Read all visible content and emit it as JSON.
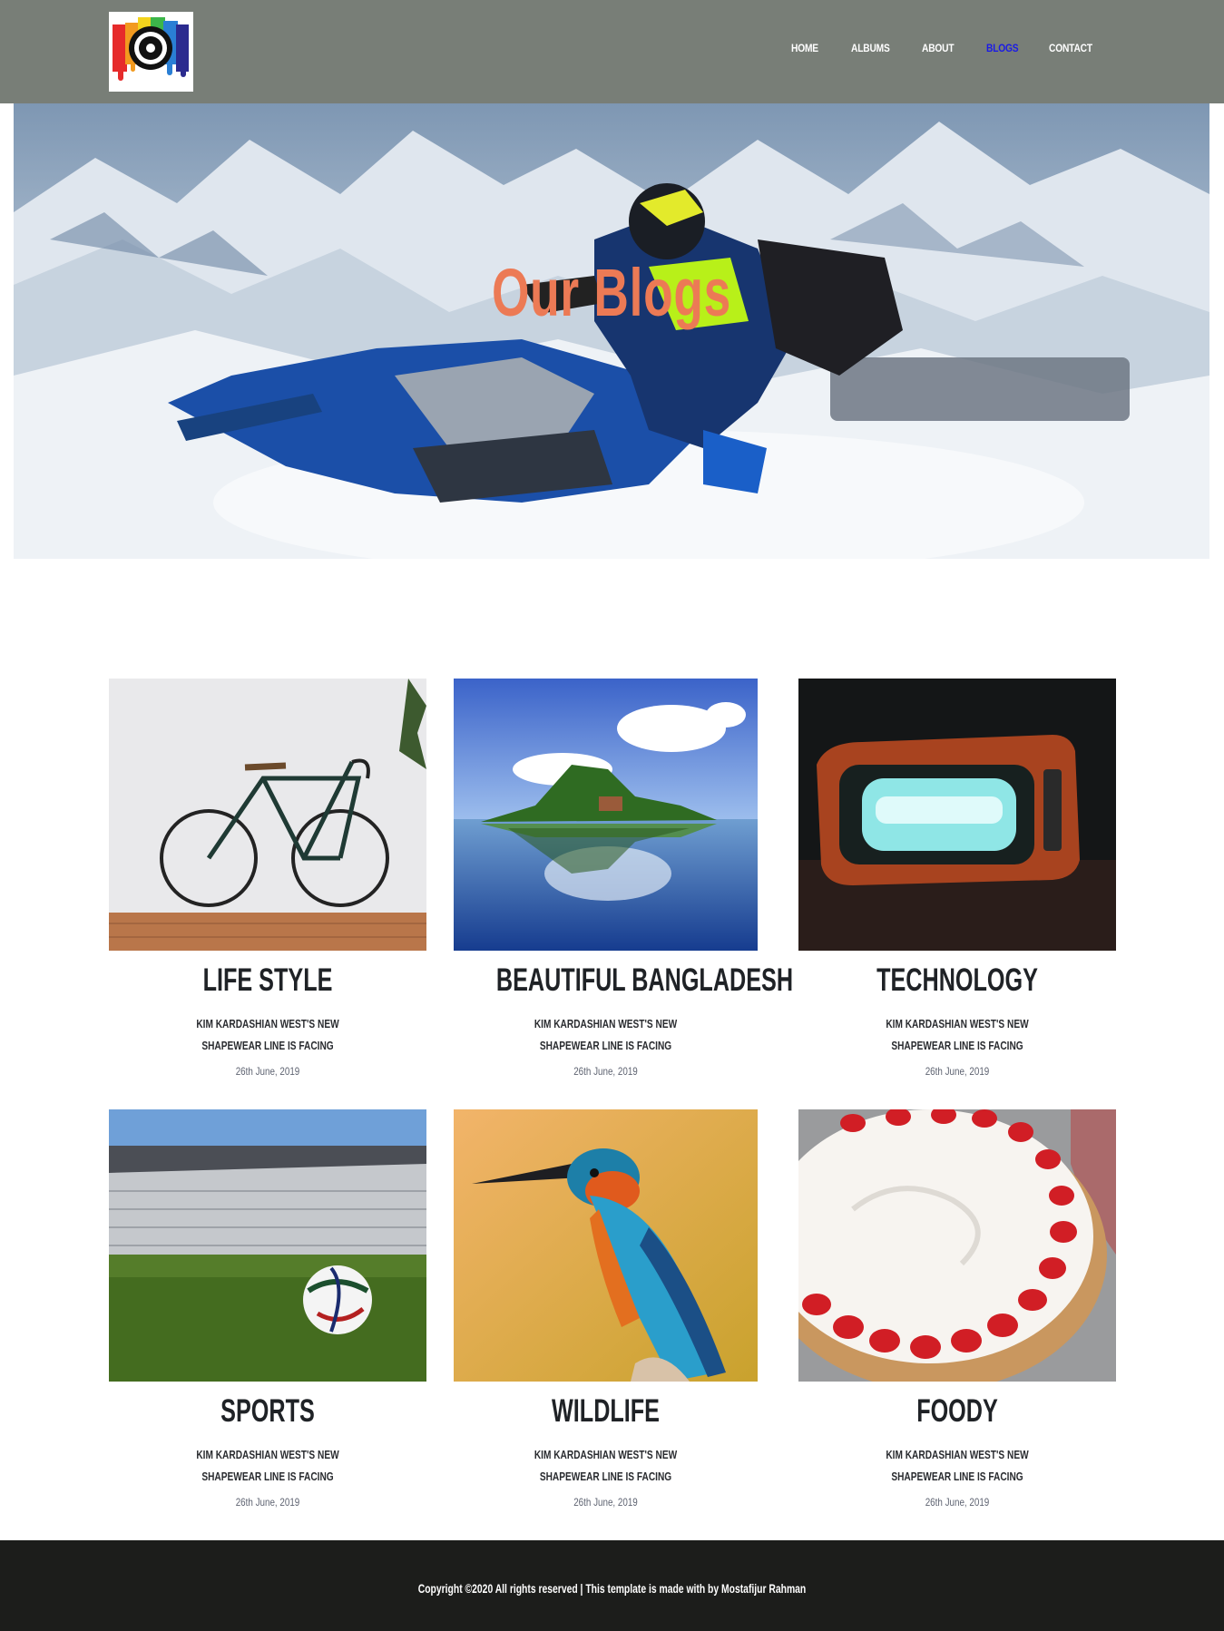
{
  "header": {
    "logo_icon": "camera-logo-icon",
    "nav": [
      {
        "label": "HOME"
      },
      {
        "label": "ALBUMS"
      },
      {
        "label": "ABOUT"
      },
      {
        "label": "BLOGS",
        "active": true
      },
      {
        "label": "CONTACT"
      }
    ],
    "colors": {
      "background": "#787e77",
      "nav_text": "#ffffff",
      "nav_active": "#1a1ae6"
    }
  },
  "hero": {
    "title": "Our Blogs",
    "title_color": "#ec7a55"
  },
  "blogs": [
    {
      "title": "LIFE STYLE",
      "excerpt_line1": "KIM KARDASHIAN WEST'S NEW",
      "excerpt_line2": "SHAPEWEAR LINE IS FACING",
      "date": "26th June, 2019",
      "image": "bicycle-photo"
    },
    {
      "title": "BEAUTIFUL BANGLADESH",
      "excerpt_line1": "KIM KARDASHIAN WEST'S NEW",
      "excerpt_line2": "SHAPEWEAR LINE IS FACING",
      "date": "26th June, 2019",
      "image": "island-lake-photo"
    },
    {
      "title": "TECHNOLOGY",
      "excerpt_line1": "KIM KARDASHIAN WEST'S NEW",
      "excerpt_line2": "SHAPEWEAR LINE IS FACING",
      "date": "26th June, 2019",
      "image": "retro-tv-photo"
    },
    {
      "title": "SPORTS",
      "excerpt_line1": "KIM KARDASHIAN WEST'S NEW",
      "excerpt_line2": "SHAPEWEAR LINE IS FACING",
      "date": "26th June, 2019",
      "image": "football-stadium-photo"
    },
    {
      "title": "WILDLIFE",
      "excerpt_line1": "KIM KARDASHIAN WEST'S NEW",
      "excerpt_line2": "SHAPEWEAR LINE IS FACING",
      "date": "26th June, 2019",
      "image": "kingfisher-photo"
    },
    {
      "title": "FOODY",
      "excerpt_line1": "KIM KARDASHIAN WEST'S NEW",
      "excerpt_line2": "SHAPEWEAR LINE IS FACING",
      "date": "26th June, 2019",
      "image": "strawberry-cake-photo"
    }
  ],
  "footer": {
    "text": "Copyright ©2020 All rights reserved | This template is made with by Mostafijur Rahman",
    "background": "#1c1d1b"
  }
}
